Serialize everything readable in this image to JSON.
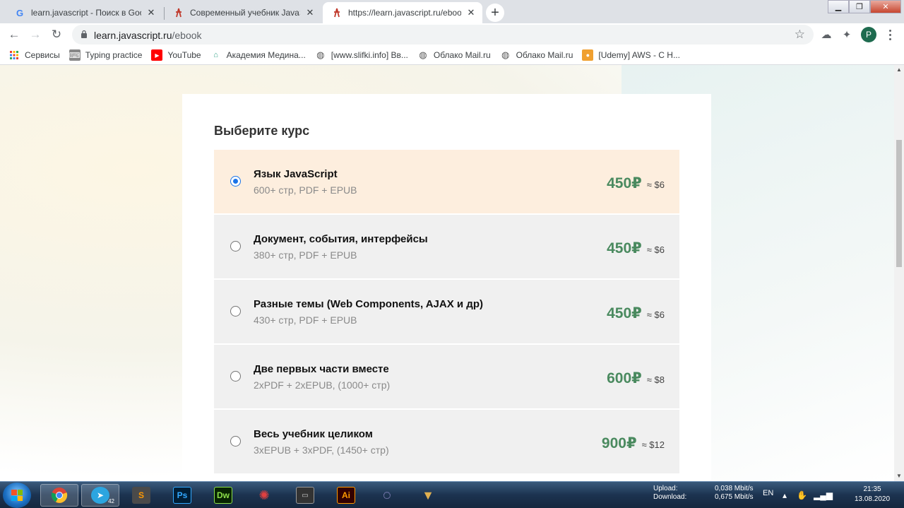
{
  "browser": {
    "tabs": [
      {
        "title": "learn.javascript - Поиск в Google",
        "favicon": "google-g-icon",
        "active": false
      },
      {
        "title": "Современный учебник JavaScript",
        "favicon": "learn-js-icon",
        "active": false
      },
      {
        "title": "https://learn.javascript.ru/ebook",
        "favicon": "learn-js-icon",
        "active": true
      }
    ],
    "close_glyph": "✕",
    "new_tab_glyph": "+",
    "url_host": "learn.javascript.ru",
    "url_path": "/ebook",
    "profile_initial": "P"
  },
  "bookmarks": [
    {
      "label": "Сервисы",
      "icon": "apps-grid-icon"
    },
    {
      "label": "Typing practice",
      "icon": "keyboard-icon"
    },
    {
      "label": "YouTube",
      "icon": "youtube-icon"
    },
    {
      "label": "Академия Медина...",
      "icon": "academy-icon"
    },
    {
      "label": "[www.slifki.info] Вв...",
      "icon": "globe-icon"
    },
    {
      "label": "Облако Mail.ru",
      "icon": "globe-icon"
    },
    {
      "label": "Облако Mail.ru",
      "icon": "globe-icon"
    },
    {
      "label": "[Udemy] AWS - С Н...",
      "icon": "udemy-icon"
    }
  ],
  "page": {
    "heading": "Выберите курс",
    "courses": [
      {
        "name": "Язык JavaScript",
        "meta": "600+ стр, PDF + EPUB",
        "price": "450₽",
        "usd": "≈ $6",
        "selected": true
      },
      {
        "name": "Документ, события, интерфейсы",
        "meta": "380+ стр, PDF + EPUB",
        "price": "450₽",
        "usd": "≈ $6",
        "selected": false
      },
      {
        "name": "Разные темы (Web Components, AJAX и др)",
        "meta": "430+ стр, PDF + EPUB",
        "price": "450₽",
        "usd": "≈ $6",
        "selected": false
      },
      {
        "name": "Две первых части вместе",
        "meta": "2xPDF + 2xEPUB, (1000+ стр)",
        "price": "600₽",
        "usd": "≈ $8",
        "selected": false
      },
      {
        "name": "Весь учебник целиком",
        "meta": "3xEPUB + 3xPDF, (1450+ стр)",
        "price": "900₽",
        "usd": "≈ $12",
        "selected": false
      }
    ]
  },
  "taskbar": {
    "apps": [
      {
        "name": "chrome",
        "label": "",
        "color": "#e8453c"
      },
      {
        "name": "telegram",
        "label": "",
        "badge": "42",
        "color": "#2ca5e0"
      },
      {
        "name": "sublime",
        "label": "S",
        "color": "#ff9800"
      },
      {
        "name": "photoshop",
        "label": "Ps",
        "color": "#31a8ff"
      },
      {
        "name": "dreamweaver",
        "label": "Dw",
        "color": "#8ce04a"
      },
      {
        "name": "network-app",
        "label": "",
        "color": "#d33"
      },
      {
        "name": "terminal",
        "label": "",
        "color": "#555"
      },
      {
        "name": "illustrator",
        "label": "Ai",
        "color": "#ff9a00"
      },
      {
        "name": "circle-app",
        "label": "",
        "color": "#a58ad8"
      },
      {
        "name": "folder-app",
        "label": "",
        "color": "#d9a64a"
      }
    ],
    "upload_label": "Upload:",
    "download_label": "Download:",
    "upload_value": "0,038 Mbit/s",
    "download_value": "0,675 Mbit/s",
    "language": "EN",
    "time": "21:35",
    "date": "13.08.2020"
  }
}
